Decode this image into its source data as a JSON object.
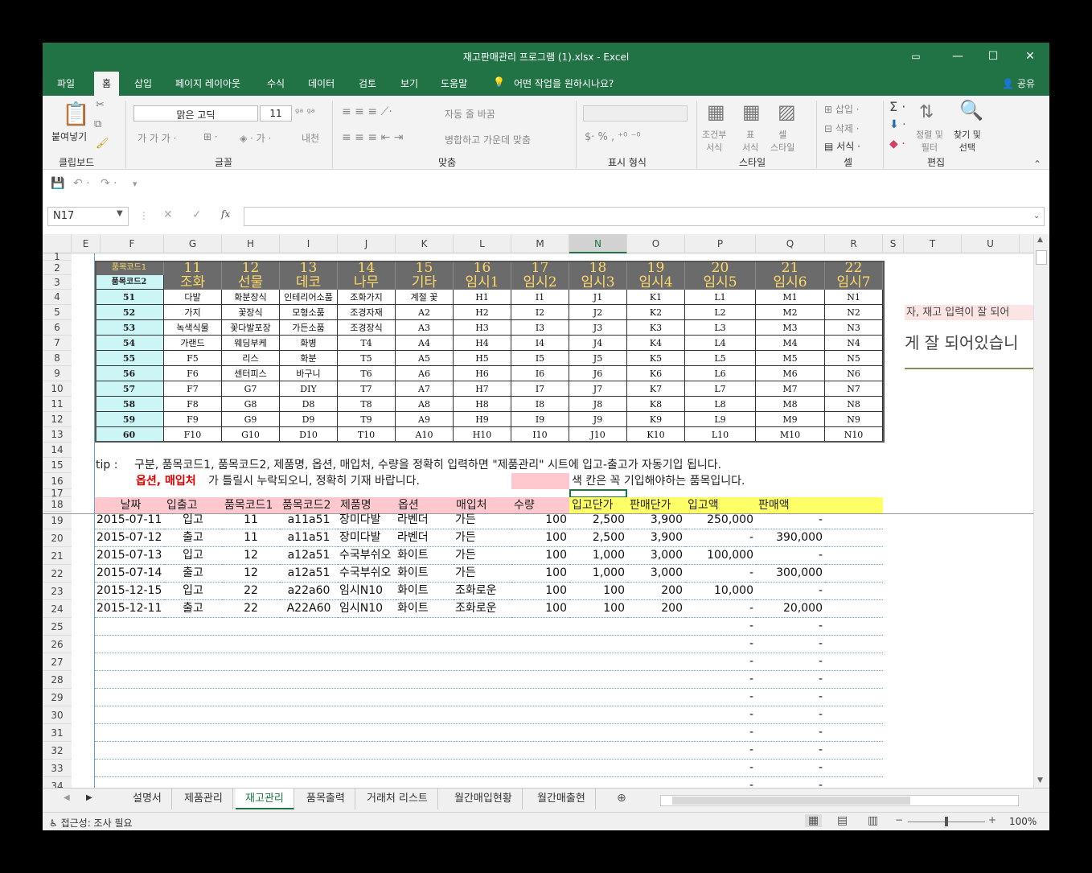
{
  "window": {
    "title": "재고판매관리 프로그램 (1).xlsx  -  Excel"
  },
  "tabs": [
    "파일",
    "홈",
    "삽입",
    "페이지 레이아웃",
    "수식",
    "데이터",
    "검토",
    "보기",
    "도움말"
  ],
  "tell_me": "어떤 작업을 원하시나요?",
  "share": "공유",
  "ribbon": {
    "paste": "붙여넣기",
    "clipboard": "클립보드",
    "font_name": "맑은 고딕",
    "font_size": "11",
    "font": "글꼴",
    "wrap": "자동 줄 바꿈",
    "merge": "병합하고 가운데 맞춤",
    "align": "맞춤",
    "number": "표시 형식",
    "cond": "조건부\n서식",
    "table": "표\n서식",
    "cellstyle": "셀\n스타일",
    "styles": "스타일",
    "insert": "삽입",
    "delete": "삭제",
    "format": "서식",
    "cells": "셀",
    "sortfilter": "정렬 및\n필터",
    "findselect": "찾기 및\n선택",
    "editing": "편집"
  },
  "namebox": "N17",
  "fx": "fx",
  "columns": [
    "E",
    "F",
    "G",
    "H",
    "I",
    "J",
    "K",
    "L",
    "M",
    "N",
    "O",
    "P",
    "Q",
    "R",
    "S",
    "T",
    "U"
  ],
  "rows": [
    "1",
    "2",
    "3",
    "4",
    "5",
    "6",
    "7",
    "8",
    "9",
    "10",
    "11",
    "12",
    "13",
    "14",
    "15",
    "16",
    "17",
    "18",
    "19",
    "20",
    "21",
    "22",
    "23",
    "24",
    "25",
    "26",
    "27",
    "28",
    "29",
    "30",
    "31",
    "32",
    "33",
    "34"
  ],
  "code_table": {
    "label1": "품목코드1",
    "label2": "품목코드2",
    "codes": [
      "11",
      "12",
      "13",
      "14",
      "15",
      "16",
      "17",
      "18",
      "19",
      "20",
      "21",
      "22"
    ],
    "names": [
      "조화",
      "선물",
      "데코",
      "나무",
      "기타",
      "임시1",
      "임시2",
      "임시3",
      "임시4",
      "임시5",
      "임시6",
      "임시7"
    ],
    "rows": [
      [
        "51",
        "다발",
        "화분장식",
        "인테리어소품",
        "조화가지",
        "계절 꽃",
        "H1",
        "I1",
        "J1",
        "K1",
        "L1",
        "M1",
        "N1"
      ],
      [
        "52",
        "가지",
        "꽃장식",
        "모형소품",
        "조경자재",
        "A2",
        "H2",
        "I2",
        "J2",
        "K2",
        "L2",
        "M2",
        "N2"
      ],
      [
        "53",
        "녹색식물",
        "꽃다발포장",
        "가든소품",
        "조경장식",
        "A3",
        "H3",
        "I3",
        "J3",
        "K3",
        "L3",
        "M3",
        "N3"
      ],
      [
        "54",
        "가랜드",
        "웨딩부케",
        "화병",
        "T4",
        "A4",
        "H4",
        "I4",
        "J4",
        "K4",
        "L4",
        "M4",
        "N4"
      ],
      [
        "55",
        "F5",
        "리스",
        "화분",
        "T5",
        "A5",
        "H5",
        "I5",
        "J5",
        "K5",
        "L5",
        "M5",
        "N5"
      ],
      [
        "56",
        "F6",
        "센터피스",
        "바구니",
        "T6",
        "A6",
        "H6",
        "I6",
        "J6",
        "K6",
        "L6",
        "M6",
        "N6"
      ],
      [
        "57",
        "F7",
        "G7",
        "DIY",
        "T7",
        "A7",
        "H7",
        "I7",
        "J7",
        "K7",
        "L7",
        "M7",
        "N7"
      ],
      [
        "58",
        "F8",
        "G8",
        "D8",
        "T8",
        "A8",
        "H8",
        "I8",
        "J8",
        "K8",
        "L8",
        "M8",
        "N8"
      ],
      [
        "59",
        "F9",
        "G9",
        "D9",
        "T9",
        "A9",
        "H9",
        "I9",
        "J9",
        "K9",
        "L9",
        "M9",
        "N9"
      ],
      [
        "60",
        "F10",
        "G10",
        "D10",
        "T10",
        "A10",
        "H10",
        "I10",
        "J10",
        "K10",
        "L10",
        "M10",
        "N10"
      ]
    ]
  },
  "side_note": {
    "line1": "자, 재고 입력이 잘 되어",
    "line2": "게 잘 되어있습니"
  },
  "tip": {
    "label": "tip  :",
    "text1": "구분, 품목코드1, 품목코드2, 제품명, 옵션, 매입처, 수량을 정확히 입력하면 \"제품관리\" 시트에 입고-출고가 자동기입 됩니다.",
    "red": "옵션, 매입처",
    "text2": "가 틀릴시 누락되오니, 정확히 기재 바랍니다.",
    "legend": "색 칸은 꼭 기입해야하는 품목입니다."
  },
  "data_headers": [
    "날짜",
    "입출고",
    "품목코드1",
    "품목코드2",
    "제품명",
    "옵션",
    "매입처",
    "수량",
    "입고단가",
    "판매단가",
    "입고액",
    "판매액"
  ],
  "data_rows": [
    [
      "2015-07-11",
      "입고",
      "11",
      "a11a51",
      "장미다발",
      "라벤더",
      "가든",
      "100",
      "2,500",
      "3,900",
      "250,000",
      "-"
    ],
    [
      "2015-07-12",
      "출고",
      "11",
      "a11a51",
      "장미다발",
      "라벤더",
      "가든",
      "100",
      "2,500",
      "3,900",
      "-",
      "390,000"
    ],
    [
      "2015-07-13",
      "입고",
      "12",
      "a12a51",
      "수국부쉬오",
      "화이트",
      "가든",
      "100",
      "1,000",
      "3,000",
      "100,000",
      "-"
    ],
    [
      "2015-07-14",
      "출고",
      "12",
      "a12a51",
      "수국부쉬오",
      "화이트",
      "가든",
      "100",
      "1,000",
      "3,000",
      "-",
      "300,000"
    ],
    [
      "2015-12-15",
      "입고",
      "22",
      "a22a60",
      "임시N10",
      "화이트",
      "조화로운",
      "100",
      "100",
      "200",
      "10,000",
      "-"
    ],
    [
      "2015-12-11",
      "출고",
      "22",
      "A22A60",
      "임시N10",
      "화이트",
      "조화로운",
      "100",
      "100",
      "200",
      "-",
      "20,000"
    ]
  ],
  "empty_dash": "-",
  "sheets": [
    "설명서",
    "제품관리",
    "재고관리",
    "품목출력",
    "거래처 리스트",
    "월간매입현황",
    "월간매출현"
  ],
  "active_sheet": "재고관리",
  "status": {
    "accessibility": "접근성: 조사 필요",
    "zoom": "100%"
  },
  "colors": {
    "excel_green": "#217346",
    "header_gray": "#6b6b6b",
    "header_text": "#ffd966",
    "code2_cyan": "#ccf5f5",
    "required_pink": "#ffc7ce",
    "calc_yellow": "#ffff66"
  }
}
